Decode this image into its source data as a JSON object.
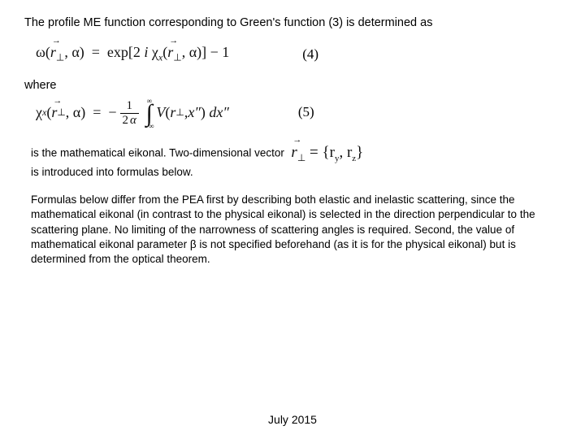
{
  "intro": "The profile ME function corresponding to Green's function (3) is determined as",
  "where": "where",
  "eq4_num": "(4)",
  "eq5_num": "(5)",
  "sent_a": "is the mathematical eikonal. Two-dimensional vector",
  "sent_b": "is introduced into formulas below.",
  "para": "Formulas below differ from the PEA first by describing both elastic and inelastic scattering, since the mathematical eikonal (in contrast to the physical eikonal) is selected in the direction perpendicular to the scattering plane. No limiting of the narrowness of scattering angles is required. Second, the value of mathematical eikonal parameter β is not specified beforehand (as it is for the physical eikonal) but is determined from the optical theorem.",
  "footer": "July 2015"
}
